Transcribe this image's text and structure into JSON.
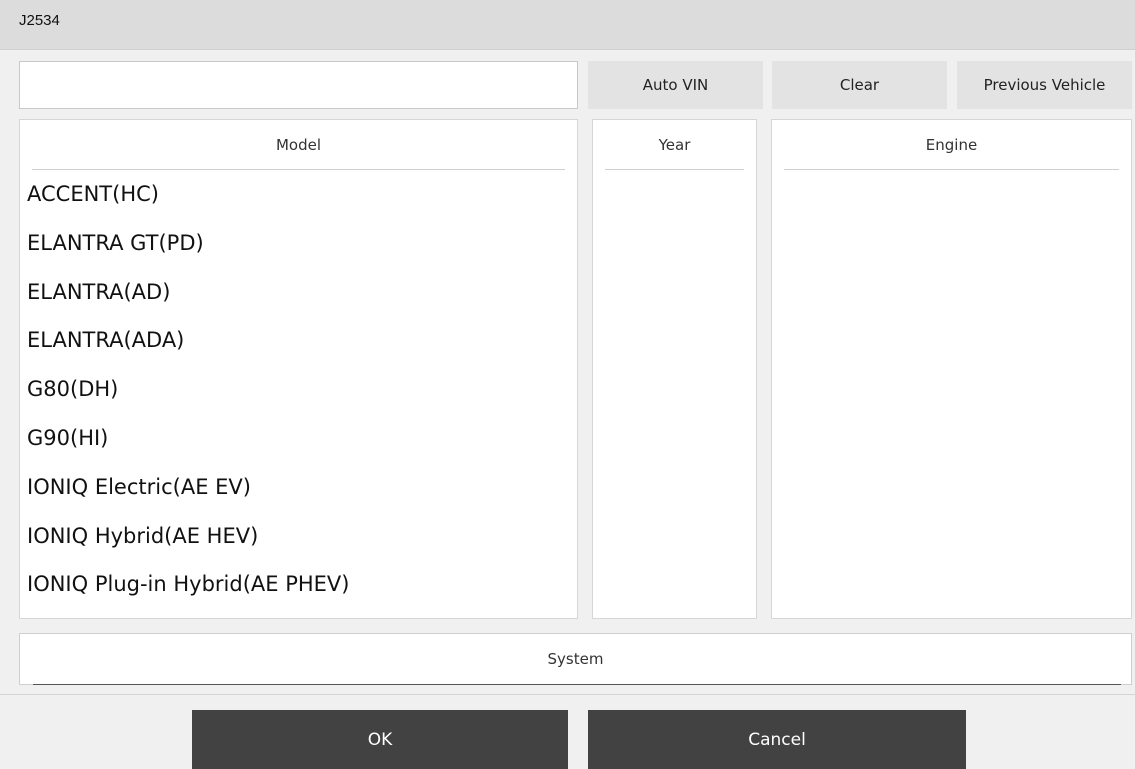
{
  "window": {
    "title": "J2534"
  },
  "vin": {
    "value": "",
    "placeholder": ""
  },
  "toolbar": {
    "auto_vin": "Auto VIN",
    "clear": "Clear",
    "previous_vehicle": "Previous Vehicle"
  },
  "columns": {
    "model": "Model",
    "year": "Year",
    "engine": "Engine"
  },
  "models": [
    "ACCENT(HC)",
    "ELANTRA GT(PD)",
    "ELANTRA(AD)",
    "ELANTRA(ADA)",
    "G80(DH)",
    "G90(HI)",
    "IONIQ Electric(AE EV)",
    "IONIQ Hybrid(AE HEV)",
    "IONIQ Plug-in Hybrid(AE PHEV)"
  ],
  "years": [],
  "engines": [],
  "system": {
    "label": "System"
  },
  "footer": {
    "ok": "OK",
    "cancel": "Cancel"
  },
  "scrollbar": {
    "grip_glyph": "≡"
  }
}
